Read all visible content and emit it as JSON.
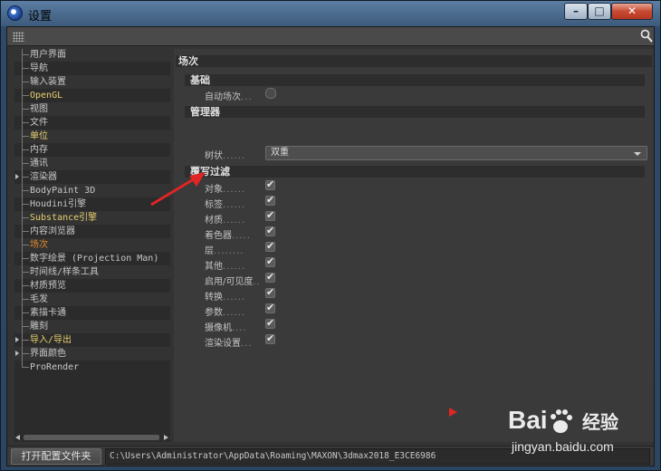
{
  "window": {
    "title": "设置",
    "controls": {
      "minimize": "–",
      "maximize": "□",
      "close": "✕"
    }
  },
  "tree": {
    "items": [
      {
        "label": "用户界面",
        "style": "normal",
        "expandable": false
      },
      {
        "label": "导航",
        "style": "normal",
        "expandable": false
      },
      {
        "label": "输入装置",
        "style": "normal",
        "expandable": false
      },
      {
        "label": "OpenGL",
        "style": "yellow",
        "expandable": false
      },
      {
        "label": "视图",
        "style": "normal",
        "expandable": false
      },
      {
        "label": "文件",
        "style": "normal",
        "expandable": false
      },
      {
        "label": "单位",
        "style": "yellow",
        "expandable": false
      },
      {
        "label": "内存",
        "style": "normal",
        "expandable": false
      },
      {
        "label": "通讯",
        "style": "normal",
        "expandable": false
      },
      {
        "label": "渲染器",
        "style": "normal",
        "expandable": true
      },
      {
        "label": "BodyPaint 3D",
        "style": "normal",
        "expandable": false
      },
      {
        "label": "Houdini引擎",
        "style": "normal",
        "expandable": false
      },
      {
        "label": "Substance引擎",
        "style": "yellow",
        "expandable": false
      },
      {
        "label": "内容浏览器",
        "style": "normal",
        "expandable": false
      },
      {
        "label": "场次",
        "style": "active",
        "expandable": false
      },
      {
        "label": "数字绘景 (Projection Man)",
        "style": "normal",
        "expandable": false
      },
      {
        "label": "时间线/样条工具",
        "style": "normal",
        "expandable": false
      },
      {
        "label": "材质预览",
        "style": "normal",
        "expandable": false
      },
      {
        "label": "毛发",
        "style": "normal",
        "expandable": false
      },
      {
        "label": "素描卡通",
        "style": "normal",
        "expandable": false
      },
      {
        "label": "雕刻",
        "style": "normal",
        "expandable": false
      },
      {
        "label": "导入/导出",
        "style": "yellow",
        "expandable": true
      },
      {
        "label": "界面颜色",
        "style": "normal",
        "expandable": true
      },
      {
        "label": "ProRender",
        "style": "normal",
        "expandable": false
      }
    ]
  },
  "panel": {
    "title": "场次",
    "basic": {
      "header": "基础",
      "auto_take_label": "自动场次",
      "auto_take_dots": "...",
      "auto_take_checked": false
    },
    "manager": {
      "header": "管理器",
      "tree_label": "树状",
      "tree_dots": "......",
      "tree_value": "双重"
    },
    "overrides": {
      "header": "覆写过滤",
      "items": [
        {
          "label": "对象",
          "dots": "......",
          "checked": true
        },
        {
          "label": "标签",
          "dots": "......",
          "checked": true
        },
        {
          "label": "材质",
          "dots": "......",
          "checked": true
        },
        {
          "label": "着色器",
          "dots": ".....",
          "checked": true
        },
        {
          "label": "层",
          "dots": "........",
          "checked": true
        },
        {
          "label": "其他",
          "dots": "......",
          "checked": true
        },
        {
          "label": "启用/可见度",
          "dots": "..",
          "checked": true
        },
        {
          "label": "转换",
          "dots": "......",
          "checked": true
        },
        {
          "label": "参数",
          "dots": "......",
          "checked": true
        },
        {
          "label": "摄像机",
          "dots": "....",
          "checked": true
        },
        {
          "label": "渲染设置",
          "dots": "...",
          "checked": true
        }
      ]
    }
  },
  "footer": {
    "open_button_label": "打开配置文件夹",
    "path": "C:\\Users\\Administrator\\AppData\\Roaming\\MAXON\\3dmax2018_E3CE6986"
  },
  "watermark": {
    "brand": "Bai",
    "brand_suffix": "经验",
    "url": "jingyan.baidu.com"
  },
  "colors": {
    "accent_active": "#e08a2c",
    "highlight_yellow": "#e8d070",
    "annotation_red": "#e02525"
  }
}
